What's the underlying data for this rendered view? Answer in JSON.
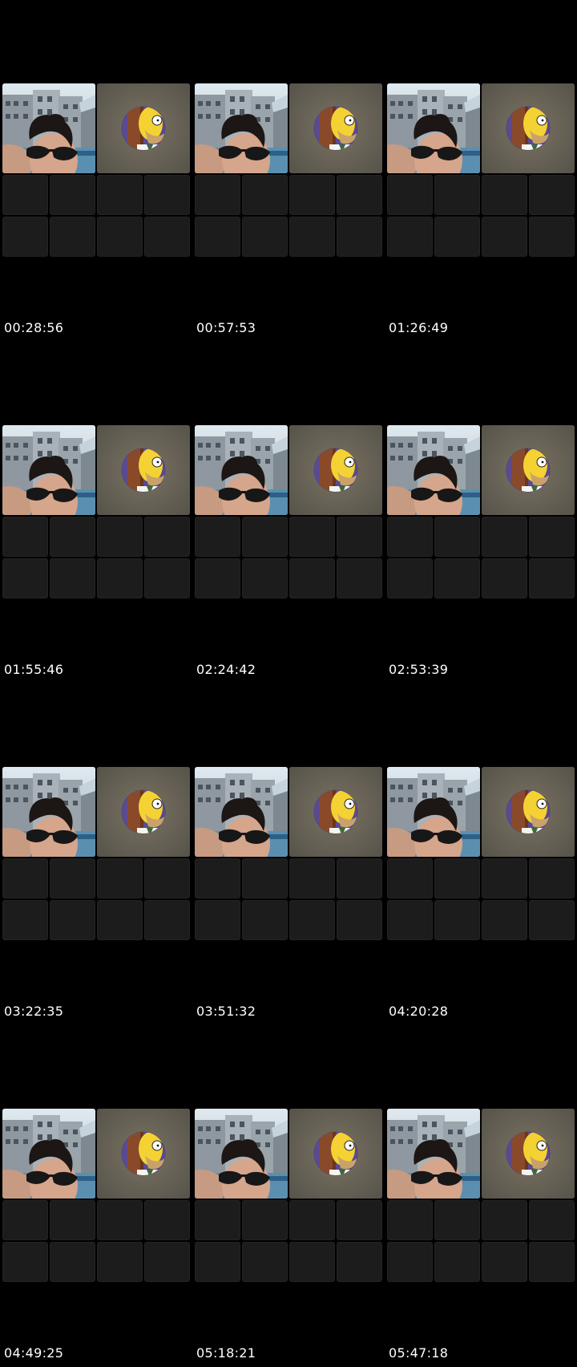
{
  "contact_sheet": {
    "frames": [
      {
        "timestamp": "00:28:56"
      },
      {
        "timestamp": "00:57:53"
      },
      {
        "timestamp": "01:26:49"
      },
      {
        "timestamp": "01:55:46"
      },
      {
        "timestamp": "02:24:42"
      },
      {
        "timestamp": "02:53:39"
      },
      {
        "timestamp": "03:22:35"
      },
      {
        "timestamp": "03:51:32"
      },
      {
        "timestamp": "04:20:28"
      },
      {
        "timestamp": "04:49:25"
      },
      {
        "timestamp": "05:18:21"
      },
      {
        "timestamp": "05:47:18"
      }
    ]
  },
  "colors": {
    "background": "#000000",
    "empty_tile": "#1b1c1b",
    "timestamp_text": "#ffffff",
    "peer_tile_bg": "#6a6558",
    "avatar_ring": "#5a4a8a"
  },
  "icons": {
    "self_video": "self-video-feed",
    "peer_avatar": "homer-avatar-icon"
  }
}
